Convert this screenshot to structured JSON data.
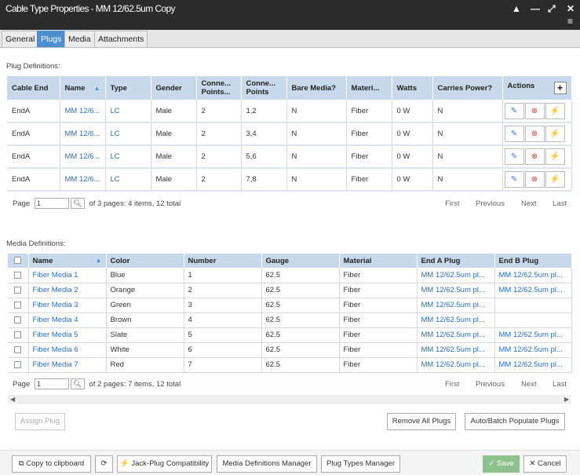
{
  "window": {
    "title": "Cable Type Properties - MM 12/62.5um Copy",
    "controls": [
      "▲",
      "—",
      "⤢",
      "✕",
      "≡"
    ]
  },
  "tabs": [
    {
      "label": "General"
    },
    {
      "label": "Plugs"
    },
    {
      "label": "Media"
    },
    {
      "label": "Attachments"
    }
  ],
  "plug_section": {
    "label": "Plug Definitions:",
    "columns": {
      "cable_end": "Cable End",
      "name": "Name",
      "type": "Type",
      "gender": "Gender",
      "conn_points_count": "Conne... Points...",
      "conn_points": "Conne... Points",
      "bare_media": "Bare Media?",
      "material": "Materi...",
      "watts": "Watts",
      "carries_power": "Carries Power?",
      "actions": "Actions"
    },
    "rows": [
      {
        "cable_end": "EndA",
        "name": "MM 12/6...",
        "type": "LC",
        "gender": "Male",
        "count": "2",
        "points": "1,2",
        "bare": "N",
        "material": "Fiber",
        "watts": "0 W",
        "power": "N"
      },
      {
        "cable_end": "EndA",
        "name": "MM 12/6...",
        "type": "LC",
        "gender": "Male",
        "count": "2",
        "points": "3,4",
        "bare": "N",
        "material": "Fiber",
        "watts": "0 W",
        "power": "N"
      },
      {
        "cable_end": "EndA",
        "name": "MM 12/6...",
        "type": "LC",
        "gender": "Male",
        "count": "2",
        "points": "5,6",
        "bare": "N",
        "material": "Fiber",
        "watts": "0 W",
        "power": "N"
      },
      {
        "cable_end": "EndA",
        "name": "MM 12/6...",
        "type": "LC",
        "gender": "Male",
        "count": "2",
        "points": "7,8",
        "bare": "N",
        "material": "Fiber",
        "watts": "0 W",
        "power": "N"
      }
    ],
    "pager": {
      "page_label": "Page",
      "page_value": "1",
      "summary": "of 3 pages: 4 items, 12 total",
      "first": "First",
      "previous": "Previous",
      "next": "Next",
      "last": "Last"
    }
  },
  "media_section": {
    "label": "Media Definitions:",
    "columns": {
      "name": "Name",
      "color": "Color",
      "number": "Number",
      "gauge": "Gauge",
      "material": "Material",
      "end_a": "End A Plug",
      "end_b": "End B Plug"
    },
    "rows": [
      {
        "name": "Fiber Media 1",
        "color": "Blue",
        "number": "1",
        "gauge": "62.5",
        "material": "Fiber",
        "end_a": "MM 12/62.5um pl...",
        "end_b": "MM 12/62.5um pl..."
      },
      {
        "name": "Fiber Media 2",
        "color": "Orange",
        "number": "2",
        "gauge": "62.5",
        "material": "Fiber",
        "end_a": "MM 12/62.5um pl...",
        "end_b": "MM 12/62.5um pl..."
      },
      {
        "name": "Fiber Media 3",
        "color": "Green",
        "number": "3",
        "gauge": "62.5",
        "material": "Fiber",
        "end_a": "MM 12/62.5um pl...",
        "end_b": ""
      },
      {
        "name": "Fiber Media 4",
        "color": "Brown",
        "number": "4",
        "gauge": "62.5",
        "material": "Fiber",
        "end_a": "MM 12/62.5um pl...",
        "end_b": ""
      },
      {
        "name": "Fiber Media 5",
        "color": "Slate",
        "number": "5",
        "gauge": "62.5",
        "material": "Fiber",
        "end_a": "MM 12/62.5um pl...",
        "end_b": "MM 12/62.5um pl..."
      },
      {
        "name": "Fiber Media 6",
        "color": "White",
        "number": "6",
        "gauge": "62.5",
        "material": "Fiber",
        "end_a": "MM 12/62.5um pl...",
        "end_b": "MM 12/62.5um pl..."
      },
      {
        "name": "Fiber Media 7",
        "color": "Red",
        "number": "7",
        "gauge": "62.5",
        "material": "Fiber",
        "end_a": "MM 12/62.5um pl...",
        "end_b": "MM 12/62.5um pl..."
      }
    ],
    "pager": {
      "page_label": "Page",
      "page_value": "1",
      "summary": "of 2 pages: 7 items, 12 total",
      "first": "First",
      "previous": "Previous",
      "next": "Next",
      "last": "Last"
    }
  },
  "buttons": {
    "assign_plug": "Assign Plug",
    "remove_all_plugs": "Remove All Plugs",
    "auto_batch": "Auto/Batch Populate Plugs",
    "copy_clipboard": "Copy to clipboard",
    "jack_plug": "Jack-Plug Compatibility",
    "media_defs": "Media Definitions Manager",
    "plug_types": "Plug Types Manager",
    "save": "Save",
    "cancel": "Cancel"
  },
  "colors": {
    "accent": "#4a8fd0",
    "header": "#c7d9ea",
    "link": "#2a6fb6",
    "titlebar": "#2b2b2b",
    "save": "#8dc28d"
  }
}
